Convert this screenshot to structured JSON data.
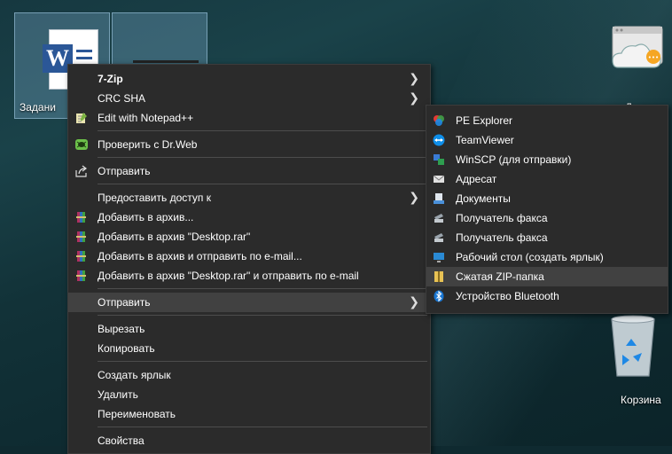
{
  "desktop": {
    "icons": {
      "word_label": "Задани",
      "cloud_label": "Другое",
      "bin_label": "Корзина"
    }
  },
  "context_menu": {
    "items": [
      {
        "label": "7-Zip",
        "icon": "none",
        "submenu": true,
        "bold": true
      },
      {
        "label": "CRC SHA",
        "icon": "none",
        "submenu": true
      },
      {
        "label": "Edit with Notepad++",
        "icon": "notepad-plus-plus-icon"
      },
      {
        "label": "Проверить с Dr.Web",
        "icon": "drweb-spider-icon"
      },
      {
        "label": "Отправить",
        "icon": "share-icon"
      },
      {
        "label": "Предоставить доступ к",
        "icon": "none",
        "submenu": true
      },
      {
        "label": "Добавить в архив...",
        "icon": "winrar-icon"
      },
      {
        "label": "Добавить в архив \"Desktop.rar\"",
        "icon": "winrar-icon"
      },
      {
        "label": "Добавить в архив и отправить по e-mail...",
        "icon": "winrar-icon"
      },
      {
        "label": "Добавить в архив \"Desktop.rar\" и отправить по e-mail",
        "icon": "winrar-icon"
      },
      {
        "label": "Отправить",
        "icon": "none",
        "submenu": true,
        "highlighted": true
      },
      {
        "label": "Вырезать",
        "icon": "none"
      },
      {
        "label": "Копировать",
        "icon": "none"
      },
      {
        "label": "Создать ярлык",
        "icon": "none"
      },
      {
        "label": "Удалить",
        "icon": "none"
      },
      {
        "label": "Переименовать",
        "icon": "none"
      },
      {
        "label": "Свойства",
        "icon": "none"
      }
    ]
  },
  "send_to_menu": {
    "items": [
      {
        "label": "PE Explorer",
        "icon": "pe-explorer-icon"
      },
      {
        "label": "TeamViewer",
        "icon": "teamviewer-icon"
      },
      {
        "label": "WinSCP (для отправки)",
        "icon": "winscp-icon"
      },
      {
        "label": "Адресат",
        "icon": "mail-recipient-icon"
      },
      {
        "label": "Документы",
        "icon": "documents-icon"
      },
      {
        "label": "Получатель факса",
        "icon": "fax-icon"
      },
      {
        "label": "Получатель факса",
        "icon": "fax-icon"
      },
      {
        "label": "Рабочий стол (создать ярлык)",
        "icon": "desktop-shortcut-icon"
      },
      {
        "label": "Сжатая ZIP-папка",
        "icon": "zip-folder-icon",
        "highlighted": true
      },
      {
        "label": "Устройство Bluetooth",
        "icon": "bluetooth-icon"
      }
    ]
  },
  "colors": {
    "menu_bg": "#2b2b2b",
    "menu_highlight": "#414141",
    "separator": "#4d4d4d"
  }
}
